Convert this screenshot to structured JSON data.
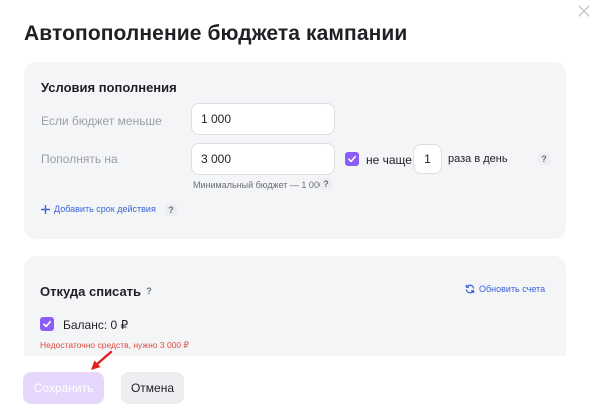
{
  "title": "Автопополнение бюджета кампании",
  "conditions": {
    "title": "Условия пополнения",
    "threshold_label": "Если бюджет меньше",
    "threshold_value": "1 000",
    "topup_label": "Пополнять на",
    "topup_value": "3 000",
    "min_budget_hint": "Минимальный бюджет — 1 000 ₽",
    "limit_checked": true,
    "limit_label": "не чаще",
    "limit_value": "1",
    "limit_suffix": "раза в день",
    "add_period_link": "Добавить срок действия"
  },
  "source": {
    "title": "Откуда списать",
    "refresh_link": "Обновить счета",
    "balance_checked": true,
    "balance_label": "Баланс: 0 ₽",
    "error": "Недостаточно средств, нужно 3 000 ₽"
  },
  "help_mark": "?",
  "buttons": {
    "save": "Сохранить",
    "cancel": "Отмена"
  },
  "colors": {
    "accent": "#8b5cf6",
    "save_disabled": "#e5d6fb",
    "link": "#3b63d9",
    "error": "#e0493f",
    "annotation_arrow": "#e02020"
  }
}
